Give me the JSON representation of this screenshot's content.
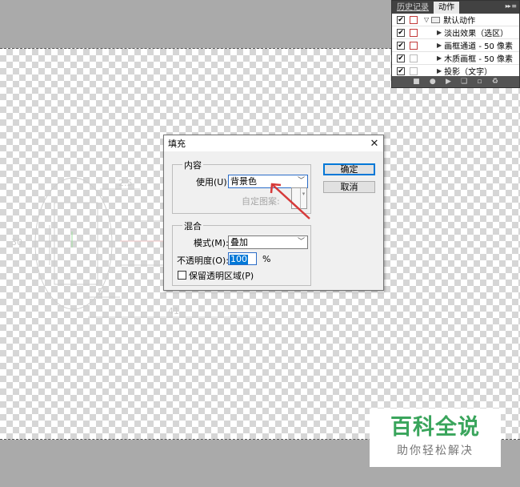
{
  "actions_panel": {
    "tabs": [
      "历史记录",
      "动作"
    ],
    "items": [
      {
        "label": "默认动作",
        "kind": "folder",
        "expanded": true,
        "dialog_on": true
      },
      {
        "label": "淡出效果（选区）",
        "kind": "action",
        "dialog_on": true
      },
      {
        "label": "画框通道 - 50 像素",
        "kind": "action",
        "dialog_on": true
      },
      {
        "label": "木质画框 - 50 像素",
        "kind": "action",
        "dialog_on": false
      },
      {
        "label": "投影（文字）",
        "kind": "action",
        "dialog_on": false
      }
    ],
    "footer_icons": [
      "stop-icon",
      "record-icon",
      "play-icon",
      "new-set-icon",
      "new-action-icon",
      "trash-icon"
    ]
  },
  "fill_dialog": {
    "title": "填充",
    "contents": {
      "legend": "内容",
      "use_label": "使用(U):",
      "use_value": "背景色",
      "custom_pattern_label": "自定图案:"
    },
    "blending": {
      "legend": "混合",
      "mode_label": "模式(M):",
      "mode_value": "叠加",
      "opacity_label": "不透明度(O):",
      "opacity_value": "100",
      "opacity_unit": "%",
      "preserve_label": "保留透明区域(P)"
    },
    "ok_label": "确定",
    "cancel_label": "取消"
  },
  "drawing_labels": [
    "2.5",
    "30",
    "5",
    "41"
  ],
  "watermark": {
    "title": "百科全说",
    "subtitle": "助你轻松解决"
  },
  "colors": {
    "arrow": "#d63a3a",
    "watermark_green": "#3aa55c",
    "accent_blue": "#0078d7"
  }
}
